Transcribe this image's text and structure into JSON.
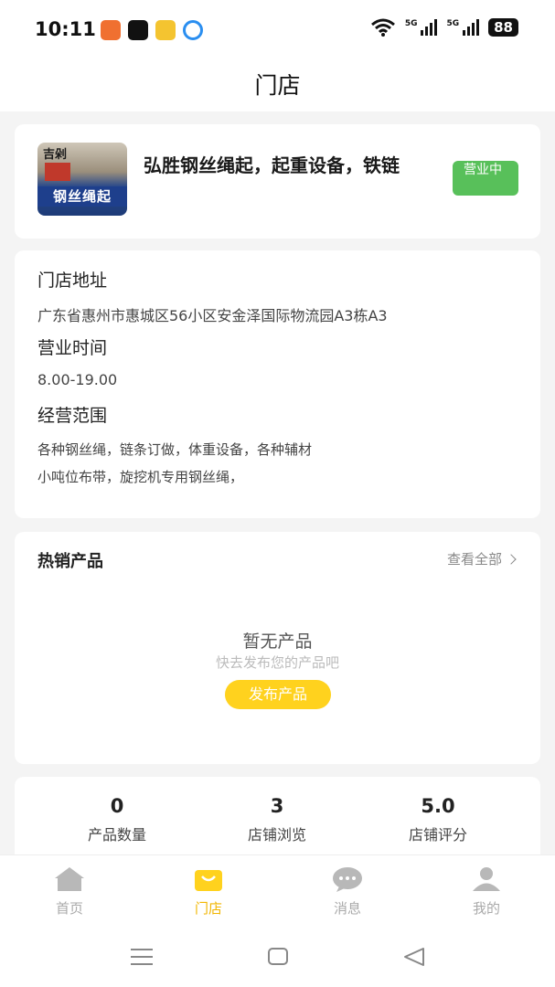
{
  "status_bar": {
    "time": "10:11",
    "battery": "88",
    "network": "5G"
  },
  "nav": {
    "title": "门店"
  },
  "store": {
    "name": "弘胜钢丝绳起，起重设备，铁链",
    "status": "营业中",
    "thumb_top": "吉剁",
    "thumb_band": "钢丝绳起"
  },
  "info": {
    "address_label": "门店地址",
    "address": "广东省惠州市惠城区56小区安金泽国际物流园A3栋A3",
    "hours_label": "营业时间",
    "hours": "8.00-19.00",
    "scope_label": "经营范围",
    "scope_line1": "各种钢丝绳，链条订做，体重设备，各种辅材",
    "scope_line2": "小吨位布带，旋挖机专用钢丝绳，"
  },
  "hot": {
    "title": "热销产品",
    "more": "查看全部",
    "empty_title": "暂无产品",
    "empty_sub": "快去发布您的产品吧",
    "publish": "发布产品"
  },
  "stats": [
    {
      "value": "0",
      "label": "产品数量"
    },
    {
      "value": "3",
      "label": "店铺浏览"
    },
    {
      "value": "5.0",
      "label": "店铺评分"
    }
  ],
  "tabs": [
    {
      "label": "首页",
      "icon": "home-icon"
    },
    {
      "label": "门店",
      "icon": "store-bag-icon"
    },
    {
      "label": "消息",
      "icon": "message-icon"
    },
    {
      "label": "我的",
      "icon": "user-icon"
    }
  ],
  "colors": {
    "accent": "#ffd21e",
    "tab_active": "#f2b600",
    "badge_green": "#58c05a"
  }
}
